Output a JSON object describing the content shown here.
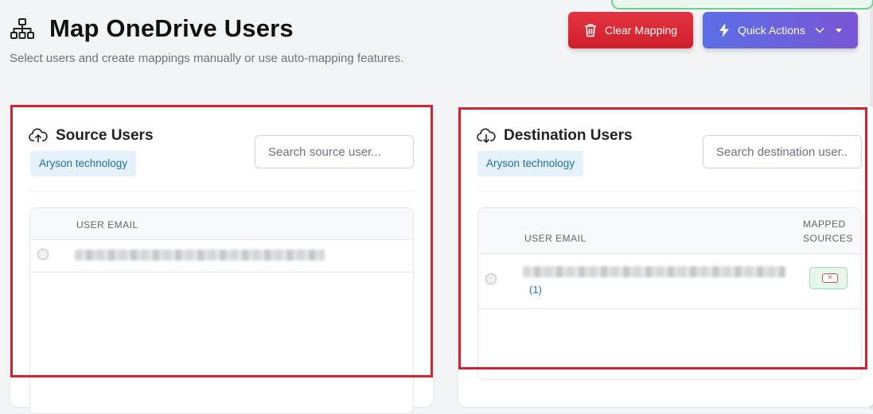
{
  "header": {
    "title": "Map OneDrive Users",
    "subtitle": "Select users and create mappings manually or use auto-mapping features.",
    "icon": "sitemap-icon"
  },
  "actions": {
    "clear_label": "Clear Mapping",
    "clear_icon": "trash-icon",
    "quick_label": "Quick Actions",
    "quick_icon": "bolt-icon"
  },
  "source": {
    "title": "Source Users",
    "icon": "cloud-upload-icon",
    "org_badge": "Aryson technology",
    "search_placeholder": "Search source user...",
    "columns": [
      "USER EMAIL"
    ]
  },
  "destination": {
    "title": "Destination Users",
    "icon": "cloud-download-icon",
    "org_badge": "Aryson technology",
    "search_placeholder": "Search destination user...",
    "columns": [
      "USER EMAIL",
      "MAPPED",
      "SOURCES"
    ],
    "rows": [
      {
        "mapped_count": "(1)",
        "remove_label": "×"
      }
    ]
  },
  "colors": {
    "danger": "#d9202e",
    "accent_blue": "#1f6fa8",
    "quick_gradient_start": "#5b6ee6",
    "quick_gradient_end": "#7a55d4"
  }
}
